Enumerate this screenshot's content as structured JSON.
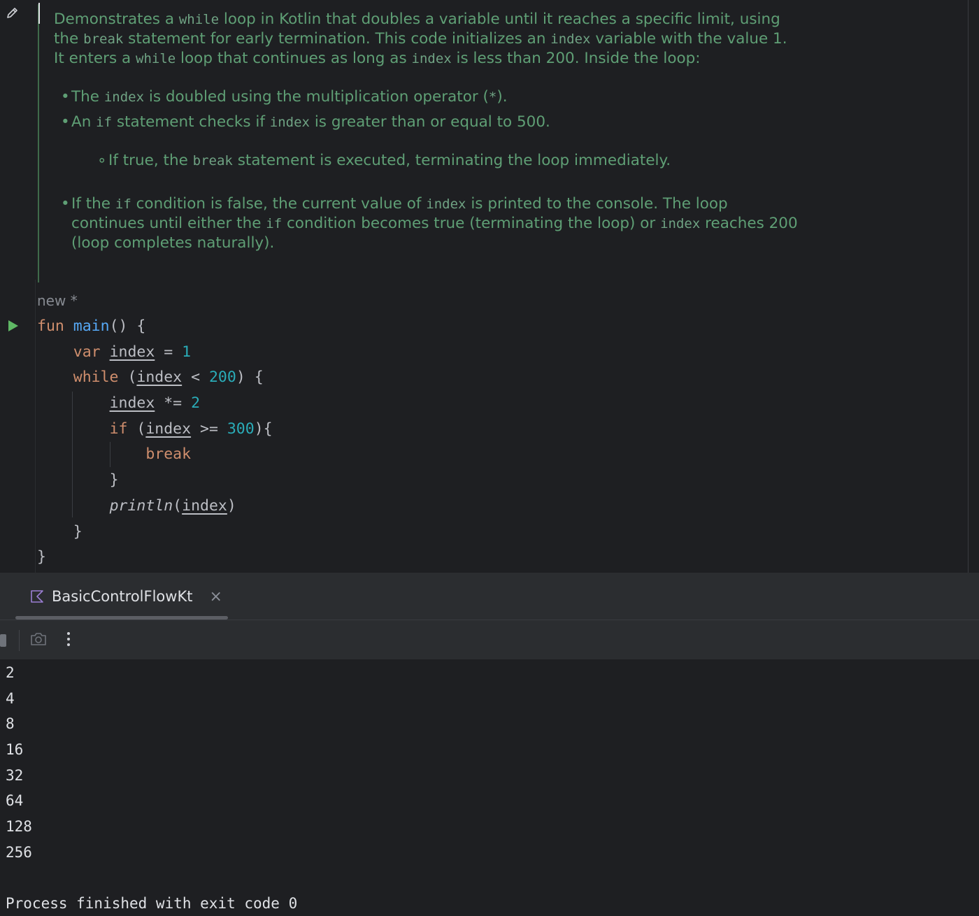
{
  "doc": {
    "para": [
      {
        "t": "Demonstrates a "
      },
      {
        "c": "while"
      },
      {
        "t": " loop in Kotlin that doubles a variable until it reaches a specific limit, using the "
      },
      {
        "c": "break"
      },
      {
        "t": " statement for early termination. This code initializes an "
      },
      {
        "c": "index"
      },
      {
        "t": " variable with the value 1. It enters a "
      },
      {
        "c": "while"
      },
      {
        "t": " loop that continues as long as "
      },
      {
        "c": "index"
      },
      {
        "t": " is less than 200. Inside the loop:"
      }
    ],
    "bullet1": [
      {
        "t": "The "
      },
      {
        "c": "index"
      },
      {
        "t": " is doubled using the multiplication operator ("
      },
      {
        "c": "*"
      },
      {
        "t": ")."
      }
    ],
    "bullet2": [
      {
        "t": "An "
      },
      {
        "c": "if"
      },
      {
        "t": " statement checks if "
      },
      {
        "c": "index"
      },
      {
        "t": " is greater than or equal to 500."
      }
    ],
    "subbullet": [
      {
        "t": "If true, the "
      },
      {
        "c": "break"
      },
      {
        "t": " statement is executed, terminating the loop immediately."
      }
    ],
    "bullet3": [
      {
        "t": "If the "
      },
      {
        "c": "if"
      },
      {
        "t": " condition is false, the current value of "
      },
      {
        "c": "index"
      },
      {
        "t": " is printed to the console. The loop continues until either the "
      },
      {
        "c": "if"
      },
      {
        "t": " condition becomes true (terminating the loop) or "
      },
      {
        "c": "index"
      },
      {
        "t": " reaches 200 (loop completes naturally)."
      }
    ]
  },
  "editor": {
    "inlay_label": "new *",
    "code": {
      "fun_kw": "fun",
      "main_name": "main",
      "main_rest": "() {",
      "var_kw": "var",
      "index": "index",
      "assign": " = ",
      "one": "1",
      "while_kw": "while",
      "while_open": " (",
      "lt": " < ",
      "two_hundred": "200",
      "while_close": ") {",
      "times_assign": " *= ",
      "two": "2",
      "if_kw": "if",
      "if_open": " (",
      "gte": " >= ",
      "three_hundred": "300",
      "if_close": "){",
      "break_kw": "break",
      "close_brace": "}",
      "println": "println",
      "paren_open": "(",
      "paren_close": ")"
    }
  },
  "run_panel": {
    "tab_label": "BasicControlFlowKt",
    "tab_close": "×",
    "output": [
      "2",
      "4",
      "8",
      "16",
      "32",
      "64",
      "128",
      "256"
    ],
    "exit_message": "Process finished with exit code 0"
  },
  "colors": {
    "background": "#1e1f22",
    "doc_text": "#5f9f75",
    "keyword": "#cf8e6d",
    "function": "#56a8f5",
    "number": "#2aacb8",
    "run_green": "#5fb865"
  }
}
